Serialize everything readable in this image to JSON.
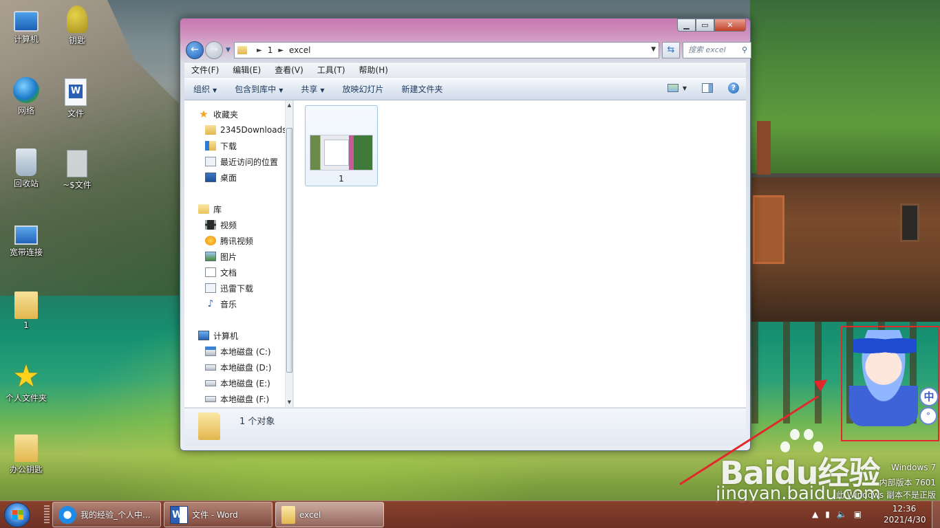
{
  "desktop": {
    "icons": [
      {
        "label": "计算机",
        "icon": "computer-icon"
      },
      {
        "label": "钥匙",
        "icon": "key-icon"
      },
      {
        "label": "网络",
        "icon": "network-icon"
      },
      {
        "label": "文件",
        "icon": "word-doc-icon"
      },
      {
        "label": "回收站",
        "icon": "recycle-bin-icon"
      },
      {
        "label": "~$文件",
        "icon": "temp-doc-icon"
      },
      {
        "label": "宽带连接",
        "icon": "broadband-icon"
      },
      {
        "label": "1",
        "icon": "folder-icon"
      },
      {
        "label": "个人文件夹",
        "icon": "star-icon"
      },
      {
        "label": "办公钥匙",
        "icon": "folder-icon"
      }
    ]
  },
  "window": {
    "address": {
      "crumbs": [
        "1",
        "excel"
      ]
    },
    "search_placeholder": "搜索 excel",
    "menu": [
      "文件(F)",
      "编辑(E)",
      "查看(V)",
      "工具(T)",
      "帮助(H)"
    ],
    "commands": [
      {
        "label": "组织",
        "dropdown": true
      },
      {
        "label": "包含到库中",
        "dropdown": true
      },
      {
        "label": "共享",
        "dropdown": true
      },
      {
        "label": "放映幻灯片",
        "dropdown": false
      },
      {
        "label": "新建文件夹",
        "dropdown": false
      }
    ],
    "nav": {
      "favorites": {
        "label": "收藏夹",
        "items": [
          "2345Downloads",
          "下载",
          "最近访问的位置",
          "桌面"
        ]
      },
      "libraries": {
        "label": "库",
        "items": [
          "视频",
          "腾讯视频",
          "图片",
          "文档",
          "迅雷下载",
          "音乐"
        ]
      },
      "computer": {
        "label": "计算机",
        "items": [
          "本地磁盘 (C:)",
          "本地磁盘 (D:)",
          "本地磁盘 (E:)",
          "本地磁盘 (F:)"
        ]
      }
    },
    "files": [
      {
        "name": "1"
      }
    ],
    "status": "1 个对象"
  },
  "ime": {
    "mode": "中"
  },
  "watermark": {
    "logo": "Baidu经验",
    "url": "jingyan.baidu.com"
  },
  "edition": {
    "line1": "Windows 7",
    "line2": "内部版本 7601",
    "line3": "此 Windows 副本不是正版"
  },
  "taskbar": {
    "buttons": [
      {
        "label": "我的经验_个人中...",
        "icon": "browser-icon"
      },
      {
        "label": "文件 - Word",
        "icon": "word-icon"
      },
      {
        "label": "excel",
        "icon": "folder-icon"
      }
    ],
    "clock": {
      "time": "12:36",
      "date": "2021/4/30"
    }
  }
}
